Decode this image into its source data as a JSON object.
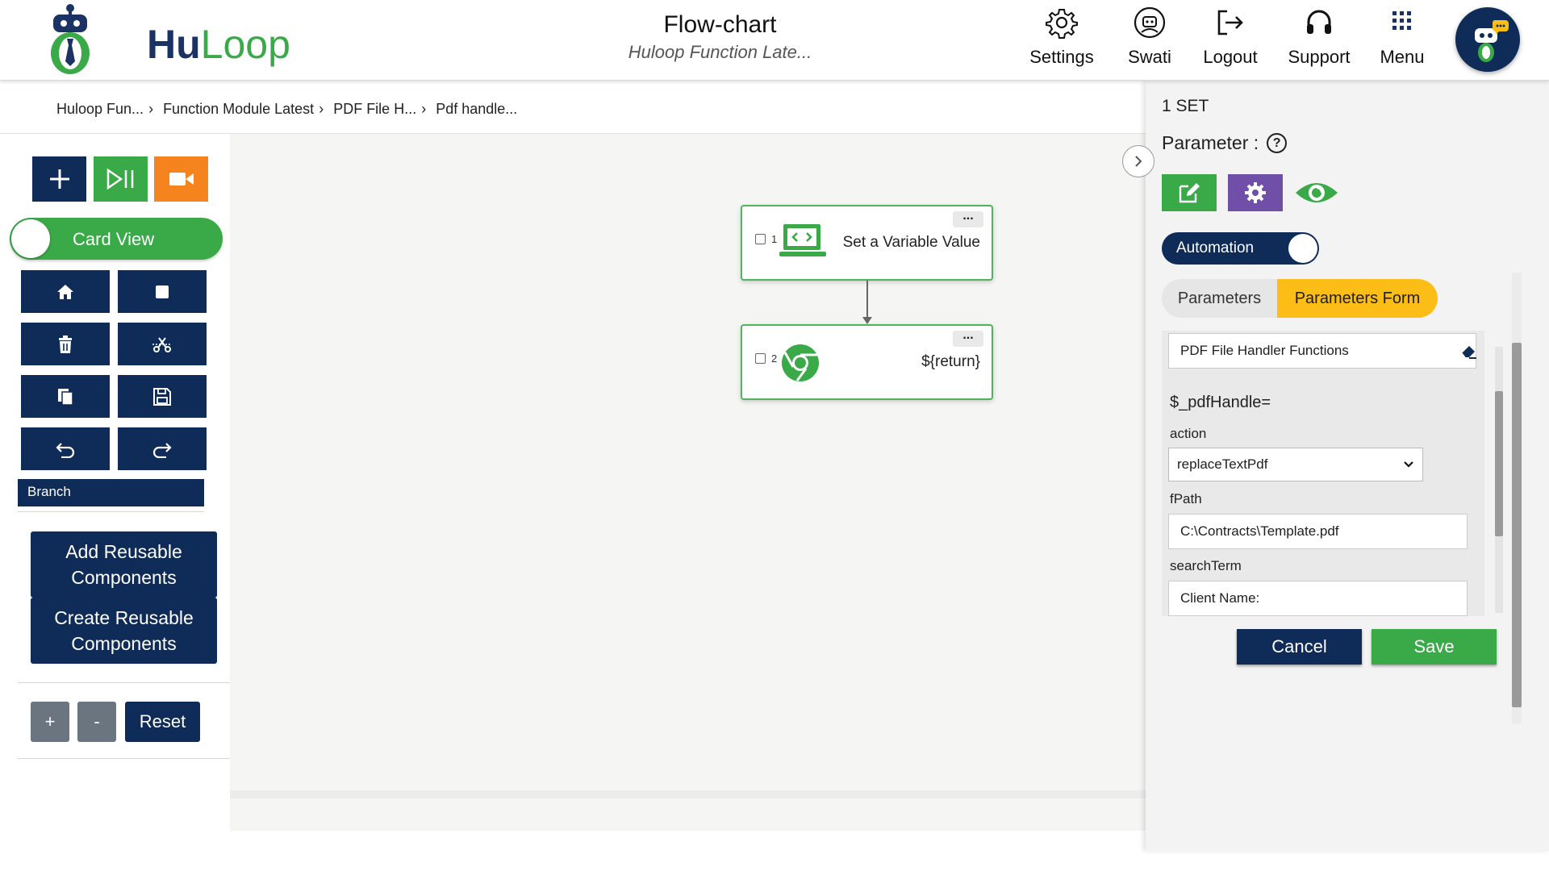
{
  "header": {
    "logo": {
      "hu": "Hu",
      "loop": "Loop"
    },
    "title": "Flow-chart",
    "subtitle": "Huloop Function Late...",
    "nav": [
      {
        "label": "Settings",
        "icon": "gear-icon"
      },
      {
        "label": "Swati",
        "icon": "user-robot-icon"
      },
      {
        "label": "Logout",
        "icon": "logout-icon"
      },
      {
        "label": "Support",
        "icon": "headset-icon"
      },
      {
        "label": "Menu",
        "icon": "grid-menu-icon"
      }
    ]
  },
  "breadcrumb": [
    "Huloop Fun...",
    "Function Module Latest",
    "PDF File H...",
    "Pdf handle..."
  ],
  "toolbar": {
    "card_view_label": "Card View",
    "branch_label": "Branch",
    "add_reusable": "Add Reusable Components",
    "create_reusable": "Create Reusable Components",
    "zoom_in": "+",
    "zoom_out": "-",
    "reset": "Reset"
  },
  "flow": {
    "nodes": [
      {
        "num": "1",
        "text": "Set a Variable Value",
        "icon": "code-laptop-icon"
      },
      {
        "num": "2",
        "text": "${return}",
        "icon": "chrome-icon"
      }
    ]
  },
  "panel": {
    "set_label": "1 SET",
    "parameter_label": "Parameter :",
    "help": "?",
    "automation_label": "Automation",
    "tabs": {
      "parameters": "Parameters",
      "form": "Parameters Form"
    },
    "function_name": "PDF File Handler Functions",
    "var_label": "$_pdfHandle=",
    "fields": {
      "action_label": "action",
      "action_value": "replaceTextPdf",
      "fpath_label": "fPath",
      "fpath_value": "C:\\Contracts\\Template.pdf",
      "search_label": "searchTerm",
      "search_value": "Client Name:"
    },
    "cancel": "Cancel",
    "save": "Save"
  },
  "colors": {
    "navy": "#0f2b57",
    "green": "#3aaa48",
    "orange": "#f5841f",
    "purple": "#6f4fa8",
    "yellow": "#fbbd16"
  }
}
